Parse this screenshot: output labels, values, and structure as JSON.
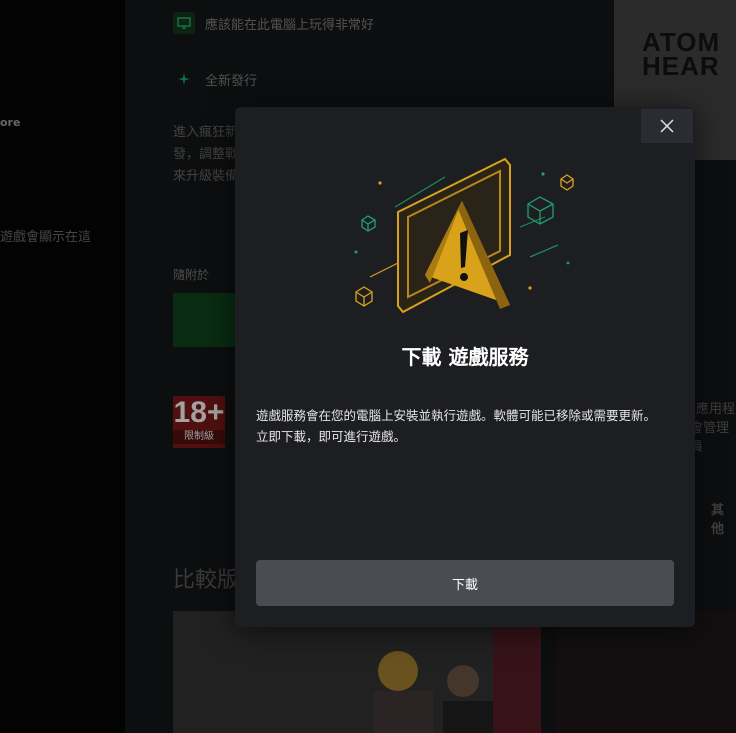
{
  "background": {
    "left_nav": {
      "store_label": "ore",
      "games_note": "遊戲會顯示在這"
    },
    "features": [
      {
        "label": "應該能在此電腦上玩得非常好",
        "icon": "monitor-check-icon"
      },
      {
        "label": "全新發行",
        "icon": "sparkle-icon"
      }
    ],
    "description_lines": [
      "進入瘋狂新",
      "發，調整戰",
      "來升級裝備"
    ],
    "bundled_label": "隨附於",
    "rating": {
      "age": "18+",
      "level": "限制級"
    },
    "compare_title": "比較版",
    "hero_title_line1": "ATOM",
    "hero_title_line2": "HEAR",
    "side_text_1": "應用程",
    "side_text_2": "會管理員",
    "side_text_3": "其他"
  },
  "modal": {
    "title": "下載 遊戲服務",
    "body_line1": "遊戲服務會在您的電腦上安裝並執行遊戲。軟體可能已移除或需要更新。",
    "body_line2": "立即下載，即可進行遊戲。",
    "download_label": "下載",
    "close_icon": "close-icon"
  },
  "colors": {
    "accent_gold": "#d9a21b",
    "accent_green": "#1fa06a",
    "button_bg": "#4a4c54"
  }
}
